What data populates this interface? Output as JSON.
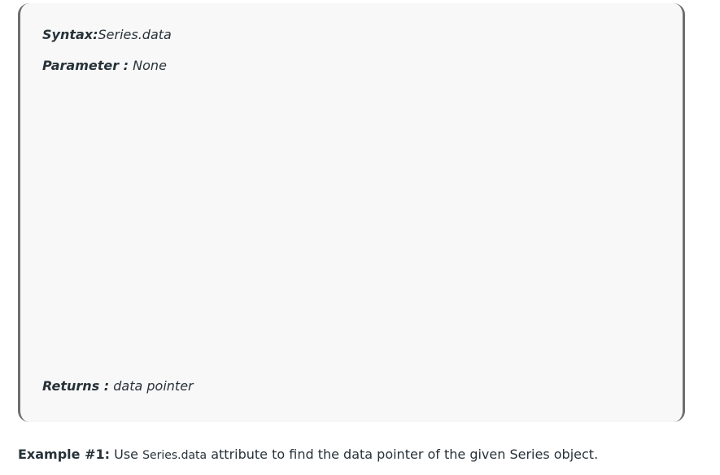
{
  "syntax_box": {
    "syntax_label": "Syntax:",
    "syntax_value": "Series.data",
    "parameter_label": "Parameter :",
    "parameter_value": " None",
    "returns_label": "Returns :",
    "returns_value": " data pointer"
  },
  "example": {
    "label": "Example #1:",
    "text_before": " Use ",
    "code": "Series.data",
    "text_after": " attribute to find the data pointer of the given Series object."
  }
}
